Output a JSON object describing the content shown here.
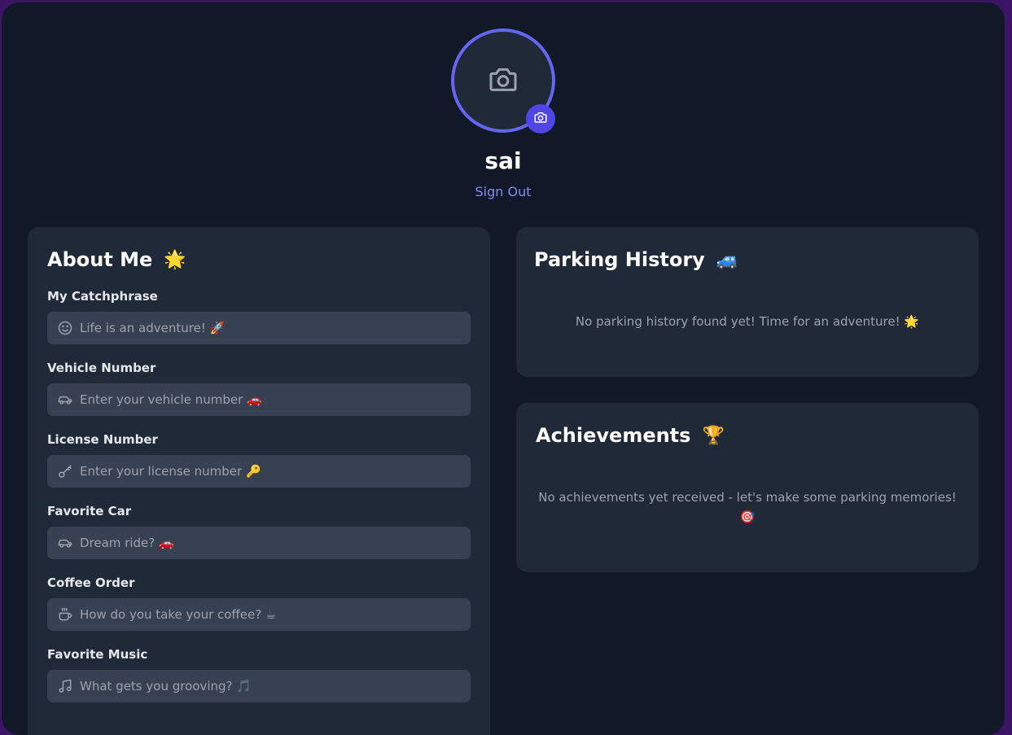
{
  "profile": {
    "username": "sai",
    "signout_label": "Sign Out"
  },
  "about": {
    "title": "About Me",
    "title_emoji": "🌟",
    "fields": [
      {
        "label": "My Catchphrase",
        "placeholder": "Life is an adventure! 🚀",
        "icon": "smile-icon"
      },
      {
        "label": "Vehicle Number",
        "placeholder": "Enter your vehicle number 🚗",
        "icon": "car-icon"
      },
      {
        "label": "License Number",
        "placeholder": "Enter your license number 🔑",
        "icon": "key-icon"
      },
      {
        "label": "Favorite Car",
        "placeholder": "Dream ride? 🚗",
        "icon": "car-icon"
      },
      {
        "label": "Coffee Order",
        "placeholder": "How do you take your coffee? ☕",
        "icon": "coffee-icon"
      },
      {
        "label": "Favorite Music",
        "placeholder": "What gets you grooving? 🎵",
        "icon": "music-icon"
      }
    ]
  },
  "parking": {
    "title": "Parking History",
    "title_emoji": "🚙",
    "empty_message": "No parking history found yet! Time for an adventure! 🌟"
  },
  "achievements": {
    "title": "Achievements",
    "title_emoji": "🏆",
    "empty_message": "No achievements yet received - let's make some parking memories! 🎯"
  },
  "colors": {
    "background": "#111827",
    "card": "#1f2937",
    "input": "#374151",
    "accent": "#6366f1",
    "link": "#818cf8",
    "outer": "#3b1466"
  }
}
